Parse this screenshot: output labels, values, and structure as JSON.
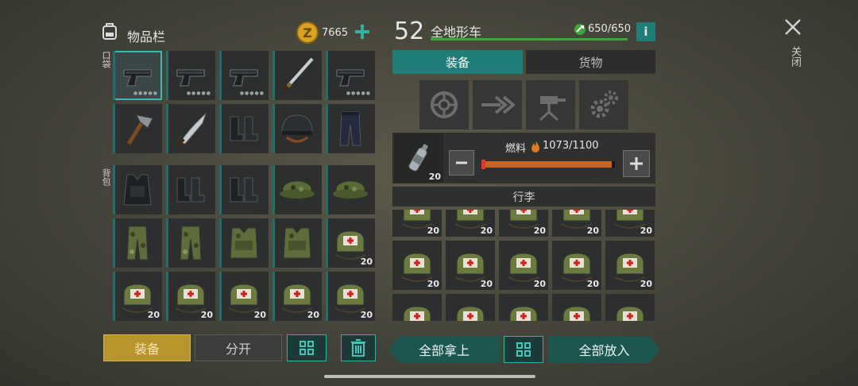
{
  "inventory": {
    "title": "物品栏",
    "coins": "7665",
    "pocket_label": "口袋",
    "backpack_label": "背包",
    "pocket_items": [
      {
        "icon": "pistol-icon",
        "qty": ""
      },
      {
        "icon": "pistol-icon",
        "qty": ""
      },
      {
        "icon": "pistol-icon",
        "qty": ""
      },
      {
        "icon": "katana-icon",
        "qty": ""
      },
      {
        "icon": "pistol-icon",
        "qty": ""
      },
      {
        "icon": "hatchet-icon",
        "qty": ""
      },
      {
        "icon": "machete-icon",
        "qty": ""
      },
      {
        "icon": "boots-icon",
        "qty": ""
      },
      {
        "icon": "helmet-icon",
        "qty": ""
      },
      {
        "icon": "pants-icon",
        "qty": ""
      }
    ],
    "backpack_items": [
      {
        "icon": "armor-vest-icon",
        "qty": ""
      },
      {
        "icon": "boots-icon",
        "qty": ""
      },
      {
        "icon": "boots-icon",
        "qty": ""
      },
      {
        "icon": "camo-cap-icon",
        "qty": ""
      },
      {
        "icon": "camo-cap-icon",
        "qty": ""
      },
      {
        "icon": "camo-pants-icon",
        "qty": ""
      },
      {
        "icon": "camo-pants-icon",
        "qty": ""
      },
      {
        "icon": "camo-vest-icon",
        "qty": ""
      },
      {
        "icon": "camo-vest-icon",
        "qty": ""
      },
      {
        "icon": "medkit-bag-icon",
        "qty": "20"
      },
      {
        "icon": "medkit-bag-icon",
        "qty": "20"
      },
      {
        "icon": "medkit-bag-icon",
        "qty": "20"
      },
      {
        "icon": "medkit-bag-icon",
        "qty": "20"
      },
      {
        "icon": "medkit-bag-icon",
        "qty": "20"
      },
      {
        "icon": "medkit-bag-icon",
        "qty": "20"
      }
    ],
    "equip_button": "装备",
    "split_button": "分开"
  },
  "vehicle": {
    "level": "52",
    "name": "全地形车",
    "durability": "650/650",
    "durability_fraction": 1.0,
    "tab_equipment": "装备",
    "tab_cargo": "货物",
    "fuel_label": "燃料",
    "fuel_value": "1073/1100",
    "fuel_fraction": 0.975,
    "fuel_item_qty": "20",
    "luggage_label": "行李",
    "luggage_qty": "20",
    "take_all_button": "全部拿上",
    "put_all_button": "全部放入"
  },
  "close_label": "关闭",
  "colors": {
    "accent_teal": "#1f7f78",
    "equip_gold": "#b8952b",
    "fuel_orange": "#c8641e",
    "durability_green": "#3fa43f"
  }
}
